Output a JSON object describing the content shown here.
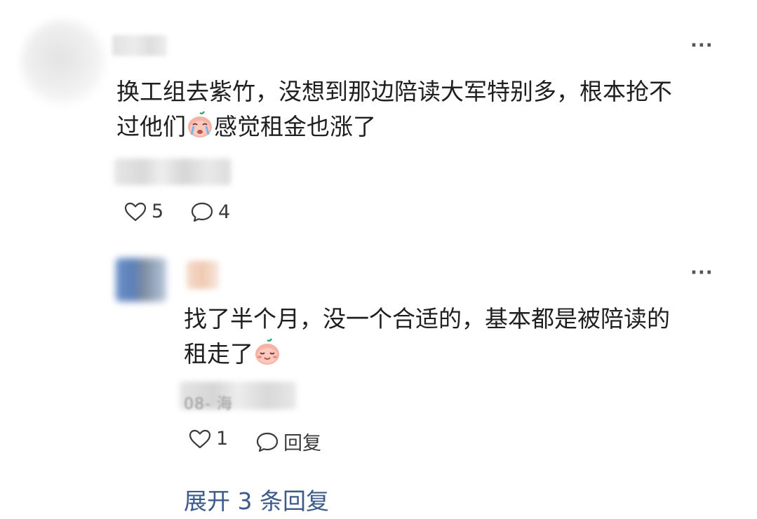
{
  "main_comment": {
    "text_line1": "换工组去紫竹，没想到那边陪读大军特别多，根本抢不",
    "text_line2_before": "过他们",
    "text_line2_after": "感觉租金也涨了",
    "emoji": "crying-face-emoji",
    "more_label": "···",
    "like_count": "5",
    "comment_count": "4"
  },
  "reply": {
    "text_line1": "找了半个月，没一个合适的，基本都是被陪读的",
    "text_line2": "租走了",
    "emoji": "smiling-blush-face-emoji",
    "meta_visible": "08-   海",
    "more_label": "···",
    "like_count": "1",
    "reply_label": "回复"
  },
  "expand_replies": "展开 3 条回复",
  "colors": {
    "text": "#1f1f1f",
    "link": "#3d5a8a",
    "icon": "#3a3a3a",
    "emoji_face": "#f7b2a6",
    "emoji_leaf": "#3aa36b"
  }
}
